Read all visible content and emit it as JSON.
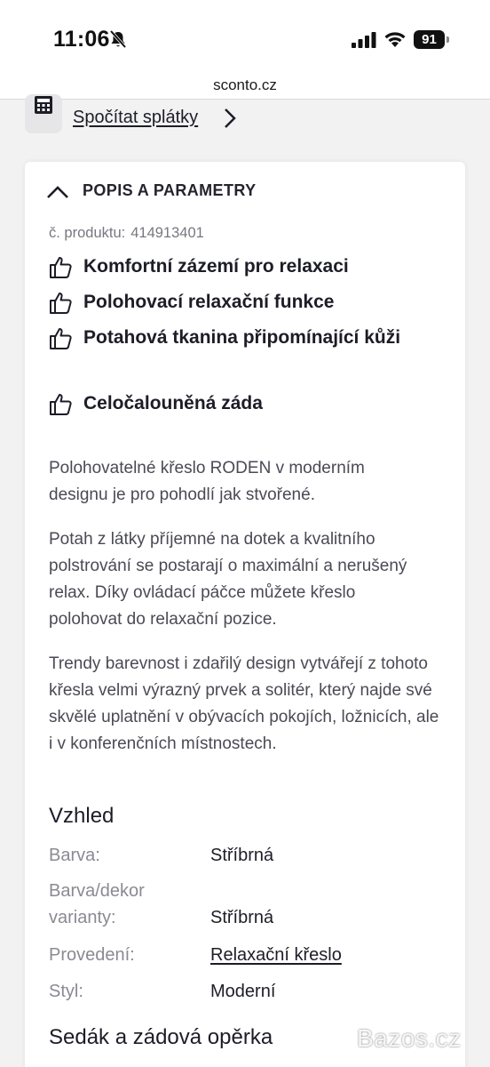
{
  "status_bar": {
    "time": "11:06",
    "battery": "91"
  },
  "browser": {
    "url": "sconto.cz"
  },
  "installments": {
    "link_label": "Spočítat splátky"
  },
  "section": {
    "title": "POPIS A PARAMETRY"
  },
  "product": {
    "code_label": "č. produktu:",
    "code_value": "414913401"
  },
  "features": [
    "Komfortní zázemí pro relaxaci",
    "Polohovací relaxační funkce",
    "Potahová tkanina připomínající kůži",
    "Celočalouněná záda"
  ],
  "description": [
    "Polohovatelné křeslo RODEN v moderním designu je pro pohodlí jak stvořené.",
    "Potah z látky příjemné na dotek a kvalitního polstrování se postarají o maximální a nerušený relax. Díky ovládací páčce můžete křeslo polohovat do relaxační pozice.",
    "Trendy barevnost i zdařilý design vytvářejí z tohoto křesla velmi výrazný prvek a solitér, který najde své skvělé uplatnění v obývacích pokojích, ložnicích, ale i v konferenčních místnostech."
  ],
  "appearance": {
    "heading": "Vzhled",
    "rows": [
      {
        "label": "Barva:",
        "value": "Stříbrná"
      },
      {
        "label": "Barva/dekor varianty:",
        "value": "Stříbrná"
      },
      {
        "label": "Provedení:",
        "value": "Relaxační křeslo"
      },
      {
        "label": "Styl:",
        "value": "Moderní"
      }
    ]
  },
  "seat_heading": "Sedák a zádová opěrka",
  "watermark": "Bazos.cz",
  "colors": {
    "text": "#1d1d28",
    "muted": "#8a8a93",
    "background": "#f2f2f2",
    "card": "#ffffff"
  }
}
